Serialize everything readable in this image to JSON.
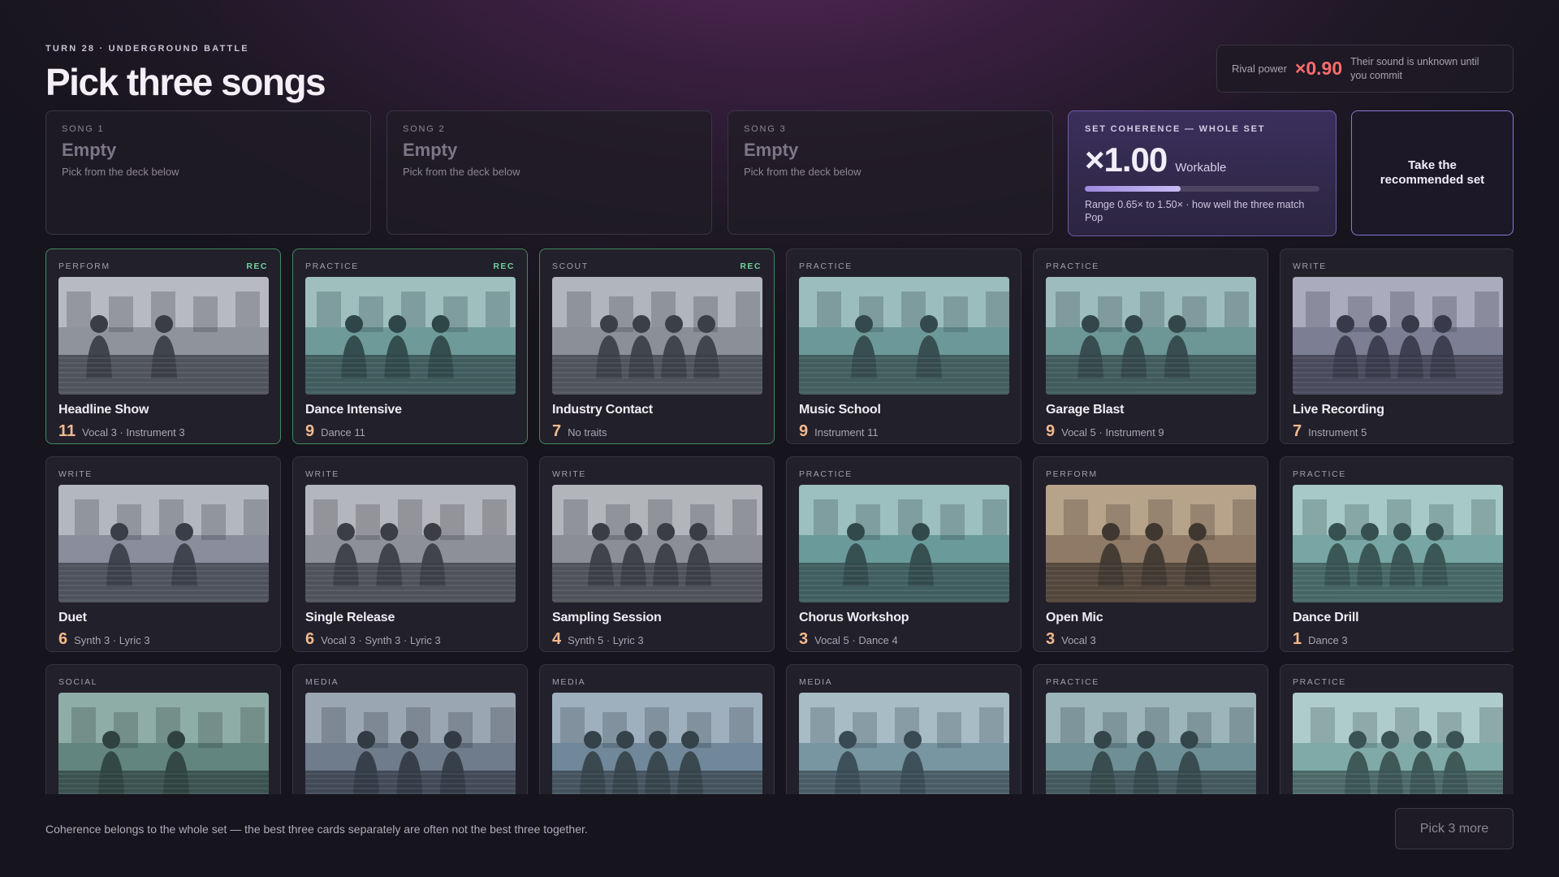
{
  "header": {
    "eyebrow": "TURN 28 · UNDERGROUND BATTLE",
    "title": "Pick three songs"
  },
  "rival": {
    "label": "Rival power",
    "value": "×0.90",
    "note": "Their sound is unknown until you commit",
    "color": "#ff6d6d"
  },
  "slots": [
    {
      "label": "SONG 1",
      "value": "Empty",
      "hint": "Pick from the deck below"
    },
    {
      "label": "SONG 2",
      "value": "Empty",
      "hint": "Pick from the deck below"
    },
    {
      "label": "SONG 3",
      "value": "Empty",
      "hint": "Pick from the deck below"
    }
  ],
  "coherence": {
    "label": "SET COHERENCE — WHOLE SET",
    "value": "×1.00",
    "status": "Workable",
    "level": 0.41,
    "note": "Range 0.65× to 1.50× · how well the three match Pop"
  },
  "recommend_button": "Take the recommended set",
  "cards": [
    {
      "type": "PERFORM",
      "rec": "REC",
      "name": "Headline Show",
      "power": "11",
      "traits": "Vocal 3 · Instrument 3",
      "art": "stage-crowd-illustration"
    },
    {
      "type": "PRACTICE",
      "rec": "REC",
      "name": "Dance Intensive",
      "power": "9",
      "traits": "Dance 11",
      "art": "exhausted-dancer-illustration"
    },
    {
      "type": "SCOUT",
      "rec": "REC",
      "name": "Industry Contact",
      "power": "7",
      "traits": "No traits",
      "art": "handshake-illustration"
    },
    {
      "type": "PRACTICE",
      "rec": "",
      "name": "Music School",
      "power": "9",
      "traits": "Instrument 11",
      "art": "classroom-illustration"
    },
    {
      "type": "PRACTICE",
      "rec": "",
      "name": "Garage Blast",
      "power": "9",
      "traits": "Vocal 5 · Instrument 9",
      "art": "garage-guitarist-illustration"
    },
    {
      "type": "WRITE",
      "rec": "",
      "name": "Live Recording",
      "power": "7",
      "traits": "Instrument 5",
      "art": "recording-desk-illustration"
    },
    {
      "type": "WRITE",
      "rec": "",
      "name": "Duet",
      "power": "6",
      "traits": "Synth 3 · Lyric 3",
      "art": "duet-singers-illustration"
    },
    {
      "type": "WRITE",
      "rec": "",
      "name": "Single Release",
      "power": "6",
      "traits": "Vocal 3 · Synth 3 · Lyric 3",
      "art": "studio-couch-illustration"
    },
    {
      "type": "WRITE",
      "rec": "",
      "name": "Sampling Session",
      "power": "4",
      "traits": "Synth 5 · Lyric 3",
      "art": "crate-digging-illustration"
    },
    {
      "type": "PRACTICE",
      "rec": "",
      "name": "Chorus Workshop",
      "power": "3",
      "traits": "Vocal 5 · Dance 4",
      "art": "choir-group-illustration"
    },
    {
      "type": "PERFORM",
      "rec": "",
      "name": "Open Mic",
      "power": "3",
      "traits": "Vocal 3",
      "art": "open-mic-illustration"
    },
    {
      "type": "PRACTICE",
      "rec": "",
      "name": "Dance Drill",
      "power": "1",
      "traits": "Dance 3",
      "art": "dance-drill-illustration"
    },
    {
      "type": "SOCIAL",
      "rec": "",
      "name": "",
      "power": "",
      "traits": "",
      "art": "backstage-chat-illustration"
    },
    {
      "type": "MEDIA",
      "rec": "",
      "name": "",
      "power": "",
      "traits": "",
      "art": "photo-shoot-illustration"
    },
    {
      "type": "MEDIA",
      "rec": "",
      "name": "",
      "power": "",
      "traits": "",
      "art": "podcast-illustration"
    },
    {
      "type": "MEDIA",
      "rec": "",
      "name": "",
      "power": "",
      "traits": "",
      "art": "selfie-video-illustration"
    },
    {
      "type": "PRACTICE",
      "rec": "",
      "name": "",
      "power": "",
      "traits": "",
      "art": "vocal-booth-illustration"
    },
    {
      "type": "PRACTICE",
      "rec": "",
      "name": "",
      "power": "",
      "traits": "",
      "art": "rehearsal-room-illustration"
    }
  ],
  "footer": {
    "note": "Coherence belongs to the whole set — the best three cards separately are often not the best three together.",
    "pick_button": "Pick 3 more"
  }
}
